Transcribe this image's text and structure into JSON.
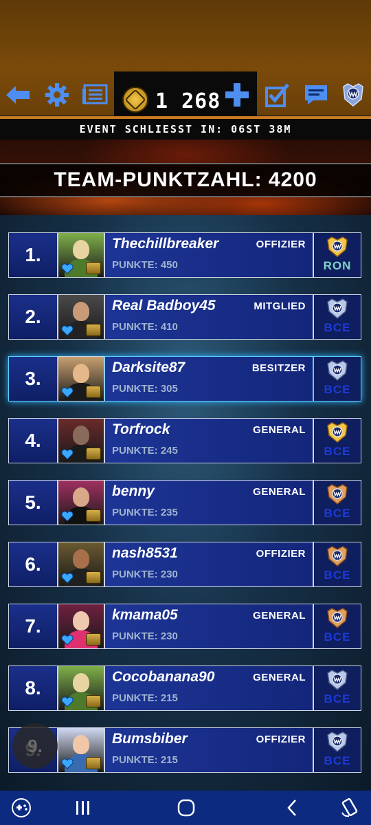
{
  "toolbar": {
    "coin_value": "1 268",
    "icons": [
      "back-arrow-icon",
      "gear-icon",
      "news-icon",
      "coin-icon",
      "plus-icon",
      "checklist-icon",
      "chat-icon",
      "wwe-crest-icon"
    ]
  },
  "event": {
    "closes_text": "EVENT SCHLIESST IN: 06ST 38M"
  },
  "team": {
    "score_text": "TEAM-PUNKTZAHL: 4200"
  },
  "colors": {
    "accent_orange": "#c87a20",
    "row_blue": "#1d3596",
    "highlight": "#5fd0ff",
    "nav_blue": "#0b2a80"
  },
  "leaderboard": [
    {
      "rank": "1.",
      "name": "Thechillbreaker",
      "role": "OFFIZIER",
      "points": "PUNKTE: 450",
      "badge": "RON",
      "badge_color": "#7fd4c8",
      "trophy": "gold"
    },
    {
      "rank": "2.",
      "name": "Real Badboy45",
      "role": "MITGLIED",
      "points": "PUNKTE: 410",
      "badge": "BCE",
      "badge_color": "#1e3ad8",
      "trophy": "silver"
    },
    {
      "rank": "3.",
      "name": "Darksite87",
      "role": "BESITZER",
      "points": "PUNKTE: 305",
      "badge": "BCE",
      "badge_color": "#1e3ad8",
      "trophy": "silver"
    },
    {
      "rank": "4.",
      "name": "Torfrock",
      "role": "GENERAL",
      "points": "PUNKTE: 245",
      "badge": "BCE",
      "badge_color": "#1e3ad8",
      "trophy": "gold"
    },
    {
      "rank": "5.",
      "name": "benny",
      "role": "GENERAL",
      "points": "PUNKTE: 235",
      "badge": "BCE",
      "badge_color": "#1e3ad8",
      "trophy": "bronze"
    },
    {
      "rank": "6.",
      "name": "nash8531",
      "role": "OFFIZIER",
      "points": "PUNKTE: 230",
      "badge": "BCE",
      "badge_color": "#1e3ad8",
      "trophy": "bronze"
    },
    {
      "rank": "7.",
      "name": "kmama05",
      "role": "GENERAL",
      "points": "PUNKTE: 230",
      "badge": "BCE",
      "badge_color": "#1e3ad8",
      "trophy": "bronze"
    },
    {
      "rank": "8.",
      "name": "Cocobanana90",
      "role": "GENERAL",
      "points": "PUNKTE: 215",
      "badge": "BCE",
      "badge_color": "#1e3ad8",
      "trophy": "silver"
    },
    {
      "rank": "9.",
      "name": "Bumsbiber",
      "role": "OFFIZIER",
      "points": "PUNKTE: 215",
      "badge": "BCE",
      "badge_color": "#1e3ad8",
      "trophy": "silver"
    }
  ],
  "navbar": {
    "icons": [
      "game-controller-icon",
      "recents-icon",
      "home-icon",
      "back-icon",
      "screen-rotate-icon"
    ]
  }
}
